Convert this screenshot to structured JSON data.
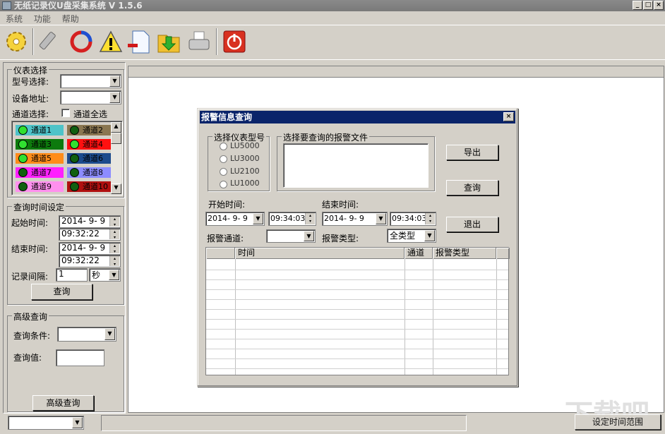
{
  "window": {
    "title": "无纸记录仪U盘采集系统 V 1.5.6",
    "controls": [
      "_",
      "□",
      "×"
    ]
  },
  "menu": [
    "系统",
    "功能",
    "帮助"
  ],
  "toolbar": [
    "settings-icon",
    "usb-icon",
    "sync-icon",
    "warning-icon",
    "remove-file-icon",
    "import-folder-icon",
    "print-icon",
    "power-icon"
  ],
  "instrument": {
    "title": "仪表选择",
    "model_label": "型号选择:",
    "model_value": "",
    "address_label": "设备地址:",
    "address_value": "",
    "channel_label": "通道选择:",
    "select_all": "通道全选",
    "channels": [
      {
        "label": "通道1",
        "bg": "#4ec3c8",
        "on": true
      },
      {
        "label": "通道2",
        "bg": "#8a7650",
        "on": false
      },
      {
        "label": "通道3",
        "bg": "#0d7a0d",
        "on": true
      },
      {
        "label": "通道4",
        "bg": "#ff1010",
        "on": true
      },
      {
        "label": "通道5",
        "bg": "#ff8c1a",
        "on": true
      },
      {
        "label": "通道6",
        "bg": "#1c4a8c",
        "on": false
      },
      {
        "label": "通道7",
        "bg": "#ff20ff",
        "on": false
      },
      {
        "label": "通道8",
        "bg": "#8c8cff",
        "on": false
      },
      {
        "label": "通道9",
        "bg": "#ff90ee",
        "on": false
      },
      {
        "label": "通道10",
        "bg": "#b01010",
        "on": false
      }
    ]
  },
  "time_query": {
    "title": "查询时间设定",
    "start_label": "起始时间:",
    "start_date": "2014-  9-  9",
    "start_time": "09:32:22",
    "end_label": "结束时间:",
    "end_date": "2014-  9-  9",
    "end_time": "09:32:22",
    "interval_label": "记录间隔:",
    "interval_value": "1",
    "interval_unit": "秒",
    "query_button": "查询"
  },
  "advanced": {
    "title": "高级查询",
    "condition_label": "查询条件:",
    "condition_value": "",
    "value_label": "查询值:",
    "value": "",
    "button": "高级查询"
  },
  "status": {
    "combo_value": "",
    "set_range_button": "设定时间范围"
  },
  "dialog": {
    "title": "报警信息查询",
    "close": "×",
    "model_group": "选择仪表型号",
    "models": [
      "LU5000",
      "LU3000",
      "LU2100",
      "LU1000"
    ],
    "file_group": "选择要查询的报警文件",
    "export_button": "导出",
    "query_button": "查询",
    "exit_button": "退出",
    "start_label": "开始时间:",
    "start_date": "2014-  9-  9",
    "start_time": "09:34:03",
    "end_label": "结束时间:",
    "end_date": "2014-  9-  9",
    "end_time": "09:34:03",
    "channel_label": "报警通道:",
    "channel_value": "",
    "type_label": "报警类型:",
    "type_value": "全类型",
    "columns": [
      "",
      "时间",
      "通道",
      "报警类型",
      ""
    ]
  }
}
